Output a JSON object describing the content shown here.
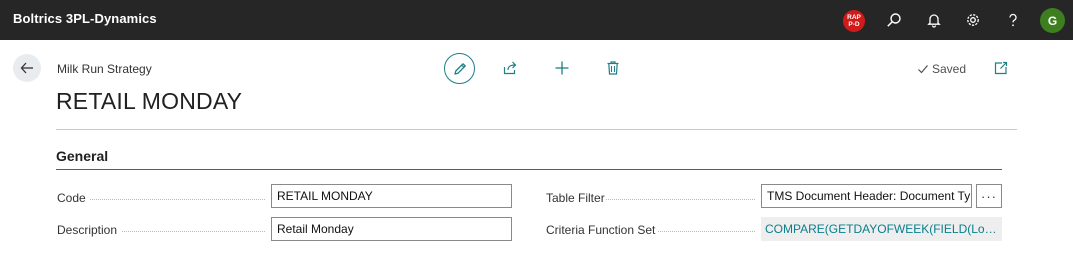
{
  "app": {
    "title": "Boltrics 3PL-Dynamics"
  },
  "topbar": {
    "badge_line1": "RAP",
    "badge_line2": "P-D",
    "icons": [
      "search-icon",
      "bell-icon",
      "gear-icon",
      "help-icon"
    ],
    "avatar_letter": "G",
    "colors": {
      "bar": "#262626",
      "badge": "#d11b1b",
      "avatar": "#3d7f1f"
    }
  },
  "page": {
    "breadcrumb": "Milk Run Strategy",
    "title": "RETAIL MONDAY",
    "saved_label": "Saved",
    "accent": "#1f7f85"
  },
  "actions": [
    "pencil-icon",
    "share-icon",
    "plus-icon",
    "trash-icon"
  ],
  "general": {
    "title": "General",
    "fields": {
      "code_label": "Code",
      "code_value": "RETAIL MONDAY",
      "description_label": "Description",
      "description_value": "Retail Monday",
      "table_filter_label": "Table Filter",
      "table_filter_value": "TMS Document Header: Document Type",
      "table_filter_button": "···",
      "criteria_label": "Criteria Function Set",
      "criteria_value": "COMPARE(GETDAYOFWEEK(FIELD(Loading ..."
    }
  }
}
